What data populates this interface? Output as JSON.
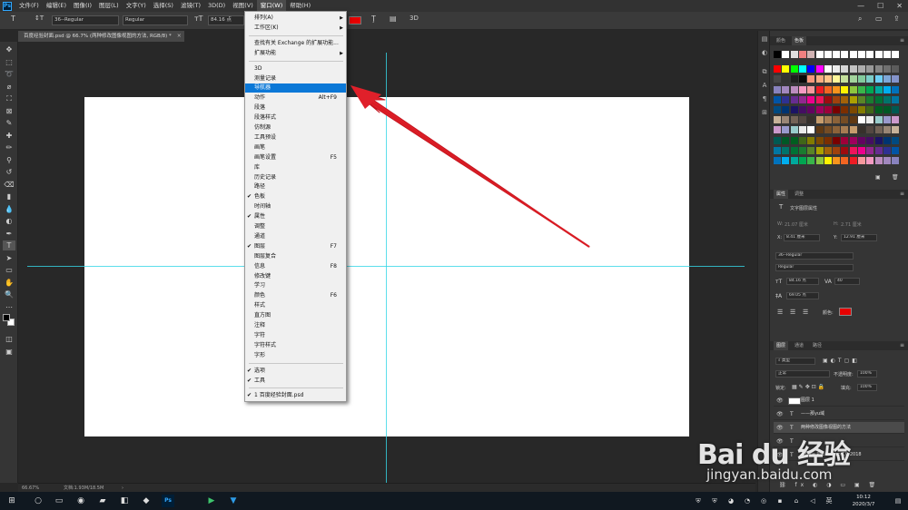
{
  "menubar": {
    "items": [
      "文件(F)",
      "编辑(E)",
      "图像(I)",
      "图层(L)",
      "文字(Y)",
      "选择(S)",
      "滤镜(T)",
      "3D(D)",
      "视图(V)",
      "窗口(W)",
      "帮助(H)"
    ],
    "active_index": 9,
    "win_controls": [
      "—",
      "☐",
      "✕"
    ]
  },
  "options": {
    "font_family": "36--Regular",
    "font_style": "Regular",
    "font_size": "84.16 点",
    "text_color": "#e60000",
    "label_3d": "3D"
  },
  "document_tab": {
    "title": "百度经验封面.psd @ 66.7% (两种修改图像视图的方法, RGB/8) *",
    "close": "×"
  },
  "window_menu": {
    "items": [
      {
        "label": "排列(A)",
        "submenu": true
      },
      {
        "label": "工作区(K)",
        "submenu": true
      },
      {
        "sep": true
      },
      {
        "label": "查找有关 Exchange 的扩展功能..."
      },
      {
        "label": "扩展功能",
        "submenu": true
      },
      {
        "sep": true
      },
      {
        "label": "3D"
      },
      {
        "label": "测量记录"
      },
      {
        "label": "导航器",
        "highlighted": true
      },
      {
        "label": "动作",
        "shortcut": "Alt+F9"
      },
      {
        "label": "段落"
      },
      {
        "label": "段落样式"
      },
      {
        "label": "仿制源"
      },
      {
        "label": "工具预设"
      },
      {
        "label": "画笔"
      },
      {
        "label": "画笔设置",
        "shortcut": "F5"
      },
      {
        "label": "库"
      },
      {
        "label": "历史记录"
      },
      {
        "label": "路径"
      },
      {
        "label": "色板",
        "checked": true
      },
      {
        "label": "时间轴"
      },
      {
        "label": "属性",
        "checked": true
      },
      {
        "label": "调整"
      },
      {
        "label": "通道"
      },
      {
        "label": "图层",
        "checked": true,
        "shortcut": "F7"
      },
      {
        "label": "图层复合"
      },
      {
        "label": "信息",
        "shortcut": "F8"
      },
      {
        "label": "修改键"
      },
      {
        "label": "学习"
      },
      {
        "label": "颜色",
        "shortcut": "F6"
      },
      {
        "label": "样式"
      },
      {
        "label": "直方图"
      },
      {
        "label": "注释"
      },
      {
        "label": "字符"
      },
      {
        "label": "字符样式"
      },
      {
        "label": "字形"
      },
      {
        "sep": true
      },
      {
        "label": "选项",
        "checked": true
      },
      {
        "label": "工具",
        "checked": true
      },
      {
        "sep": true
      },
      {
        "label": "1 百度经验封面.psd",
        "checked": true
      }
    ]
  },
  "swatches_panel": {
    "tabs": [
      "颜色",
      "色板"
    ],
    "active_tab": 1
  },
  "properties_panel": {
    "tabs": [
      "属性",
      "调整"
    ],
    "active_tab": 0,
    "layer_type": "文字图层属性",
    "w_label": "W:",
    "w_value": "21.07 厘米",
    "h_label": "H:",
    "h_value": "2.71 厘米",
    "x_label": "X:",
    "x_value": "8.41 厘米",
    "y_label": "Y:",
    "y_value": "12.91 厘米",
    "font": "36--Regular",
    "style": "Regular",
    "size": "84.16 点",
    "tracking": "40",
    "leading": "69.05 点",
    "color_label": "颜色:",
    "color": "#e60000"
  },
  "layers_panel": {
    "tabs": [
      "图层",
      "通道",
      "路径"
    ],
    "active_tab": 0,
    "filter": "类型",
    "blend": "正常",
    "opacity_label": "不透明度:",
    "opacity": "100%",
    "lock_label": "锁定:",
    "fill_label": "填充:",
    "fill": "100%",
    "layers": [
      {
        "name": "图层 1",
        "kind": "pixel"
      },
      {
        "name": "——那yu域",
        "kind": "text"
      },
      {
        "name": "两种修改图像视图的方法",
        "kind": "text",
        "selected": true
      },
      {
        "name": "",
        "kind": "text"
      },
      {
        "name": "Adobe Photoshop CC 2018",
        "kind": "text"
      }
    ]
  },
  "status": {
    "zoom": "66.67%",
    "doc": "文档:1.93M/18.5M"
  },
  "taskbar": {
    "time": "10:12",
    "date": "2020/3/7"
  },
  "watermark": {
    "line1": "Bai du 经验",
    "line2": "jingyan.baidu.com"
  }
}
